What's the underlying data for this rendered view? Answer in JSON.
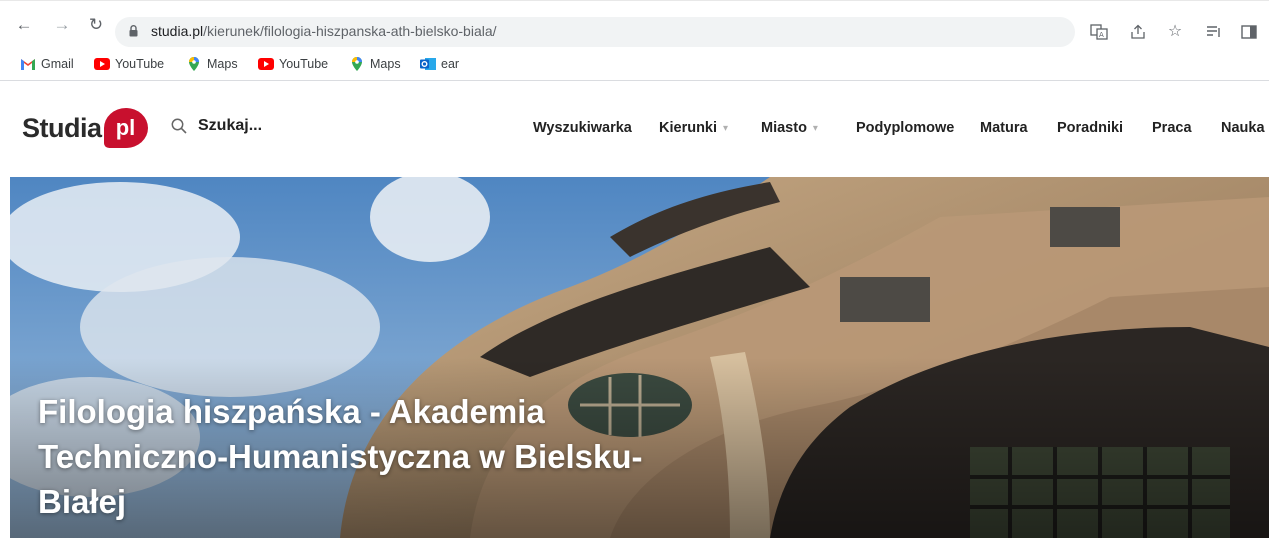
{
  "browser": {
    "url_host": "studia.pl",
    "url_path": "/kierunek/filologia-hiszpanska-ath-bielsko-biala/",
    "bookmarks": [
      {
        "label": "Gmail",
        "icon": "gmail-icon"
      },
      {
        "label": "YouTube",
        "icon": "youtube-icon"
      },
      {
        "label": "Maps",
        "icon": "maps-icon"
      },
      {
        "label": "YouTube",
        "icon": "youtube-icon"
      },
      {
        "label": "Maps",
        "icon": "maps-icon"
      },
      {
        "label": "ear",
        "icon": "outlook-icon"
      }
    ]
  },
  "site": {
    "logo_text": "Studia",
    "logo_badge": "pl",
    "search_label": "Szukaj...",
    "menu": [
      {
        "label": "Wyszukiwarka",
        "dropdown": false
      },
      {
        "label": "Kierunki",
        "dropdown": true
      },
      {
        "label": "Miasto",
        "dropdown": true
      },
      {
        "label": "Podyplomowe",
        "dropdown": false
      },
      {
        "label": "Matura",
        "dropdown": false
      },
      {
        "label": "Poradniki",
        "dropdown": false
      },
      {
        "label": "Praca",
        "dropdown": false
      },
      {
        "label": "Nauka",
        "dropdown": false
      }
    ],
    "caret": "▾"
  },
  "hero": {
    "title": "Filologia hiszpańska - Akademia Techniczno-Humanistyczna w Bielsku-Białej"
  },
  "colors": {
    "brand": "#c8102e",
    "sky": "#5b8fc7",
    "stone": "#b89a78"
  }
}
